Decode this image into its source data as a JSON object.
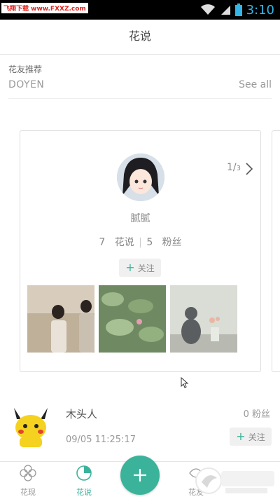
{
  "status_bar": {
    "watermark": "飞翔下载 www.FXXZ.com",
    "time": "3:10"
  },
  "header": {
    "title": "花说"
  },
  "recommend": {
    "label": "花友推荐",
    "subtitle": "DOYEN",
    "see_all": "See all"
  },
  "card": {
    "pager_current": "1",
    "pager_total": "3",
    "user_name": "腻腻",
    "posts_count": "7",
    "posts_label": "花说",
    "fans_count": "5",
    "fans_label": "粉丝",
    "follow_label": "关注"
  },
  "feed": {
    "user_name": "木头人",
    "date": "09/05 11:25:17",
    "fans": "0 粉丝",
    "follow_label": "关注"
  },
  "tabs": [
    {
      "label": "花现"
    },
    {
      "label": "花说"
    },
    {
      "label": "花友"
    }
  ],
  "colors": {
    "accent": "#3bb39b",
    "status_time": "#33b5e5"
  }
}
